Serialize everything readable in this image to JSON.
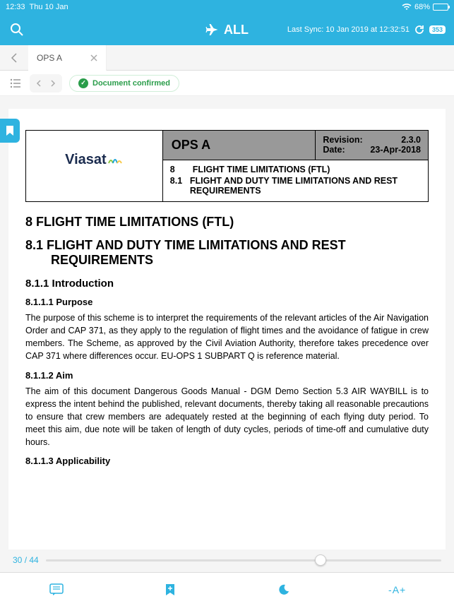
{
  "status": {
    "time": "12:33",
    "date": "Thu 10 Jan",
    "signal_icon": "wifi",
    "battery_pct": "68%"
  },
  "topbar": {
    "center_label": "ALL",
    "last_sync": "Last Sync: 10 Jan 2019 at 12:32:51",
    "sync_badge": "353"
  },
  "tabs": {
    "current": "OPS A"
  },
  "toolbar": {
    "confirmed_label": "Document confirmed"
  },
  "doc": {
    "header": {
      "logo": "Viasat",
      "title": "OPS A",
      "revision_label": "Revision:",
      "revision_value": "2.3.0",
      "date_label": "Date:",
      "date_value": "23-Apr-2018",
      "sec8_num": "8",
      "sec8_title": "FLIGHT TIME LIMITATIONS (FTL)",
      "sec81_num": "8.1",
      "sec81_title": "FLIGHT AND DUTY TIME LIMITATIONS AND REST REQUIREMENTS"
    },
    "h8": "8   FLIGHT TIME LIMITATIONS (FTL)",
    "h81_a": "8.1 FLIGHT AND DUTY TIME LIMITATIONS AND REST",
    "h81_b": "REQUIREMENTS",
    "h811": "8.1.1 Introduction",
    "h8111": "8.1.1.1 Purpose",
    "p8111": "The purpose of this scheme is to interpret the requirements of the relevant articles of the Air Navigation Order and CAP 371, as they apply to the regulation of flight times and the avoidance of fatigue in crew members. The Scheme, as approved by the Civil Aviation Authority, therefore takes precedence over CAP 371 where differences occur. EU-OPS 1 SUBPART Q is reference material.",
    "h8112": "8.1.1.2 Aim",
    "p8112": "The aim of this document Dangerous Goods Manual - DGM Demo Section 5.3 AIR WAYBILL is to express the intent behind the published, relevant documents, thereby taking all reasonable precautions to ensure that crew members are adequately rested at the beginning of each flying duty period. To meet this aim, due note will be taken of length of duty cycles, periods of time-off and cumulative duty hours.",
    "h8113": "8.1.1.3 Applicability"
  },
  "pager": {
    "current": "30",
    "total": "44",
    "sep": " / "
  },
  "bottombar": {
    "font_label": "-A+"
  }
}
